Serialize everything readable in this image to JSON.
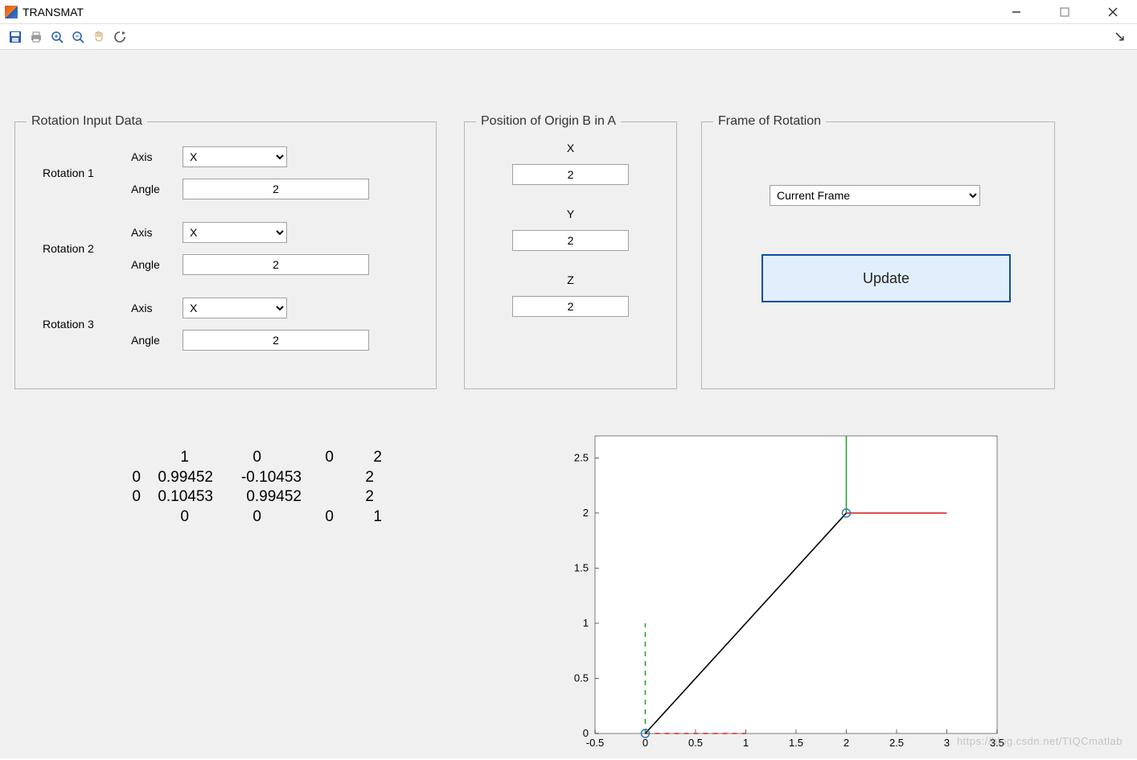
{
  "window": {
    "title": "TRANSMAT"
  },
  "toolbar": {
    "icons": [
      "save",
      "print",
      "zoom-in",
      "zoom-out",
      "pan",
      "reset"
    ]
  },
  "panels": {
    "rotation": {
      "legend": "Rotation Input Data",
      "axis_label": "Axis",
      "angle_label": "Angle",
      "rows": [
        {
          "label": "Rotation 1",
          "axis": "X",
          "angle": "2"
        },
        {
          "label": "Rotation 2",
          "axis": "X",
          "angle": "2"
        },
        {
          "label": "Rotation 3",
          "axis": "X",
          "angle": "2"
        }
      ]
    },
    "position": {
      "legend": "Position of Origin B in A",
      "x_label": "X",
      "y_label": "Y",
      "z_label": "Z",
      "x": "2",
      "y": "2",
      "z": "2"
    },
    "frame": {
      "legend": "Frame of Rotation",
      "selected": "Current Frame",
      "options": [
        "Current Frame"
      ],
      "update_label": "Update"
    }
  },
  "matrix": {
    "rows": [
      [
        "1",
        "0",
        "0",
        "2"
      ],
      [
        "0",
        "0.99452",
        "-0.10453",
        "2"
      ],
      [
        "0",
        "0.10453",
        "0.99452",
        "2"
      ],
      [
        "0",
        "0",
        "0",
        "1"
      ]
    ]
  },
  "chart_data": {
    "type": "line",
    "title": "",
    "xlabel": "",
    "ylabel": "",
    "xlim": [
      -0.5,
      3.5
    ],
    "ylim": [
      0,
      2.7
    ],
    "xticks": [
      -0.5,
      0,
      0.5,
      1,
      1.5,
      2,
      2.5,
      3,
      3.5
    ],
    "yticks": [
      0,
      0.5,
      1,
      1.5,
      2,
      2.5
    ],
    "series": [
      {
        "name": "frameA-x-axis",
        "color": "#d62728",
        "style": "dashed",
        "x": [
          0,
          1
        ],
        "y": [
          0,
          0
        ]
      },
      {
        "name": "frameA-y-axis",
        "color": "#2ca02c",
        "style": "dashed",
        "x": [
          0,
          0
        ],
        "y": [
          0,
          1
        ]
      },
      {
        "name": "frameB-x-axis",
        "color": "#d62728",
        "style": "solid",
        "x": [
          2,
          3
        ],
        "y": [
          2,
          2
        ]
      },
      {
        "name": "frameB-y-axis",
        "color": "#2ca02c",
        "style": "solid",
        "x": [
          2,
          2
        ],
        "y": [
          2,
          2.7
        ]
      },
      {
        "name": "origin-link",
        "color": "#000000",
        "style": "solid",
        "x": [
          0,
          2
        ],
        "y": [
          0,
          2
        ]
      }
    ],
    "markers": [
      {
        "name": "origin-A",
        "x": 0,
        "y": 0,
        "shape": "open-circle",
        "color": "#1f77b4"
      },
      {
        "name": "origin-B",
        "x": 2,
        "y": 2,
        "shape": "open-circle",
        "color": "#1f77b4"
      }
    ]
  },
  "watermark": "https://blog.csdn.net/TIQCmatlab"
}
